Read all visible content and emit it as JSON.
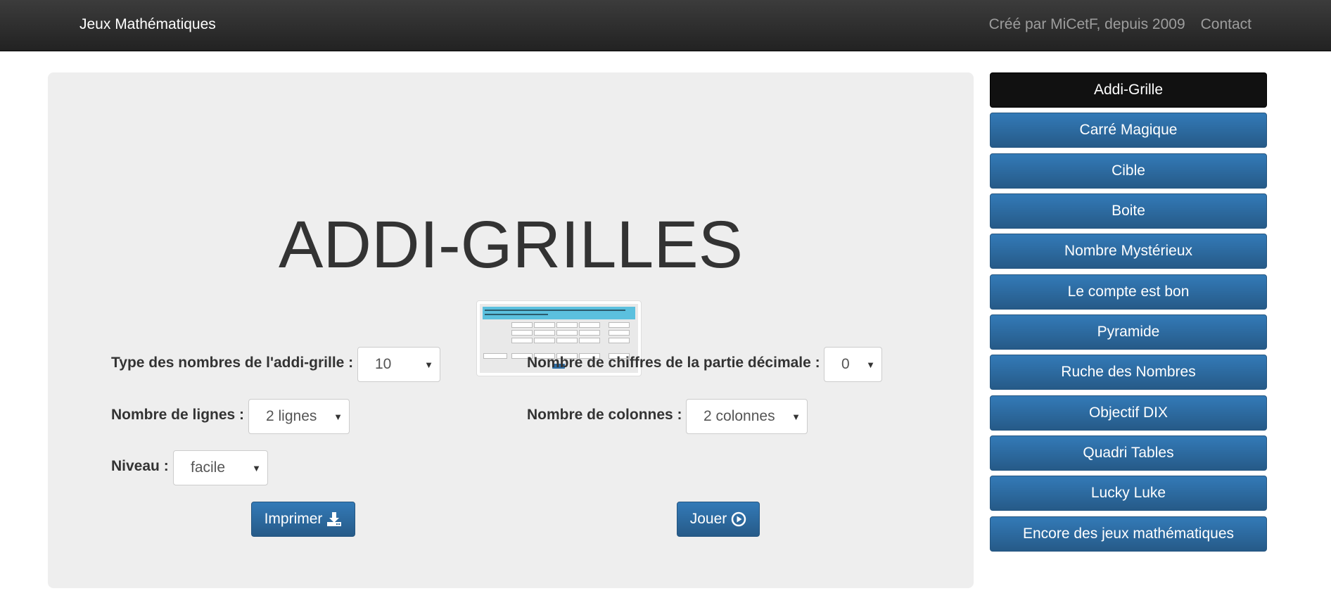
{
  "navbar": {
    "brand": "Jeux Mathématiques",
    "credit": "Créé par MiCetF, depuis 2009",
    "contact": "Contact"
  },
  "main": {
    "title": "ADDI-GRILLES",
    "form": {
      "type_label": "Type des nombres de l'addi-grille :",
      "type_value": "10",
      "decimals_label": "Nombre de chiffres de la partie décimale :",
      "decimals_value": "0",
      "rows_label": "Nombre de lignes :",
      "rows_value": "2 lignes",
      "cols_label": "Nombre de colonnes :",
      "cols_value": "2 colonnes",
      "level_label": "Niveau :",
      "level_value": "facile"
    },
    "print_label": "Imprimer",
    "play_label": "Jouer"
  },
  "sidebar": {
    "items": [
      {
        "label": "Addi-Grille",
        "active": true
      },
      {
        "label": "Carré Magique"
      },
      {
        "label": "Cible"
      },
      {
        "label": "Boite"
      },
      {
        "label": "Nombre Mystérieux"
      },
      {
        "label": "Le compte est bon"
      },
      {
        "label": "Pyramide"
      },
      {
        "label": "Ruche des Nombres"
      },
      {
        "label": "Objectif DIX"
      },
      {
        "label": "Quadri Tables"
      },
      {
        "label": "Lucky Luke"
      },
      {
        "label": "Encore des jeux mathématiques"
      }
    ]
  },
  "colors": {
    "navbar": "#222222",
    "primary": "#337ab7",
    "active": "#111111",
    "panel": "#eeeeee"
  },
  "icons": {
    "print": "download-icon",
    "play": "play-circle-icon"
  }
}
